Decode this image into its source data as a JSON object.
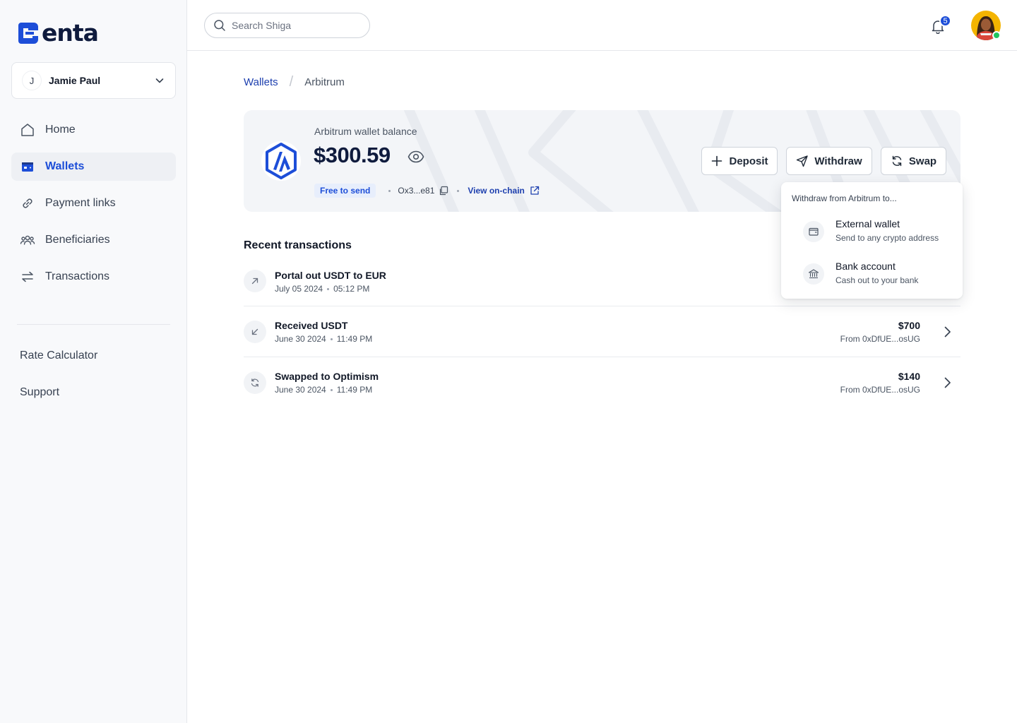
{
  "brand": {
    "name": "enta"
  },
  "account": {
    "initial": "J",
    "name": "Jamie Paul"
  },
  "nav": [
    {
      "label": "Home",
      "icon": "home-icon"
    },
    {
      "label": "Wallets",
      "icon": "wallet-icon",
      "active": true
    },
    {
      "label": "Payment links",
      "icon": "link-icon"
    },
    {
      "label": "Beneficiaries",
      "icon": "users-icon"
    },
    {
      "label": "Transactions",
      "icon": "arrows-icon"
    }
  ],
  "footer_links": [
    "Rate Calculator",
    "Support"
  ],
  "search": {
    "placeholder": "Search Shiga",
    "value": ""
  },
  "notifications": {
    "count": "5"
  },
  "breadcrumb": {
    "parent": "Wallets",
    "separator": "/",
    "current": "Arbitrum"
  },
  "wallet": {
    "balance_label": "Arbitrum wallet balance",
    "balance": "$300.59",
    "status": "Free to send",
    "address": "Ox3...e81",
    "view_link": "View on-chain"
  },
  "actions": {
    "deposit": "Deposit",
    "withdraw": "Withdraw",
    "swap": "Swap"
  },
  "withdraw_menu": {
    "heading": "Withdraw from Arbitrum to...",
    "options": [
      {
        "title": "External wallet",
        "subtitle": "Send to any crypto address",
        "icon": "wallet-icon"
      },
      {
        "title": "Bank account",
        "subtitle": "Cash out to your bank",
        "icon": "bank-icon"
      }
    ]
  },
  "transactions": {
    "title": "Recent transactions",
    "items": [
      {
        "name": "Portal out USDT to EUR",
        "date": "July 05 2024",
        "time": "05:12 PM",
        "amount": "",
        "from": "",
        "icon": "arrow-up-right-icon"
      },
      {
        "name": "Received USDT",
        "date": "June 30 2024",
        "time": "11:49 PM",
        "amount": "$700",
        "from": "From 0xDfUE...osUG",
        "icon": "arrow-down-left-icon"
      },
      {
        "name": "Swapped to Optimism",
        "date": "June 30 2024",
        "time": "11:49 PM",
        "amount": "$140",
        "from": "From 0xDfUE...osUG",
        "icon": "swap-icon"
      }
    ]
  },
  "colors": {
    "accent": "#1d4ed8",
    "brand_dark": "#0f1b3d",
    "online": "#22c55e"
  }
}
